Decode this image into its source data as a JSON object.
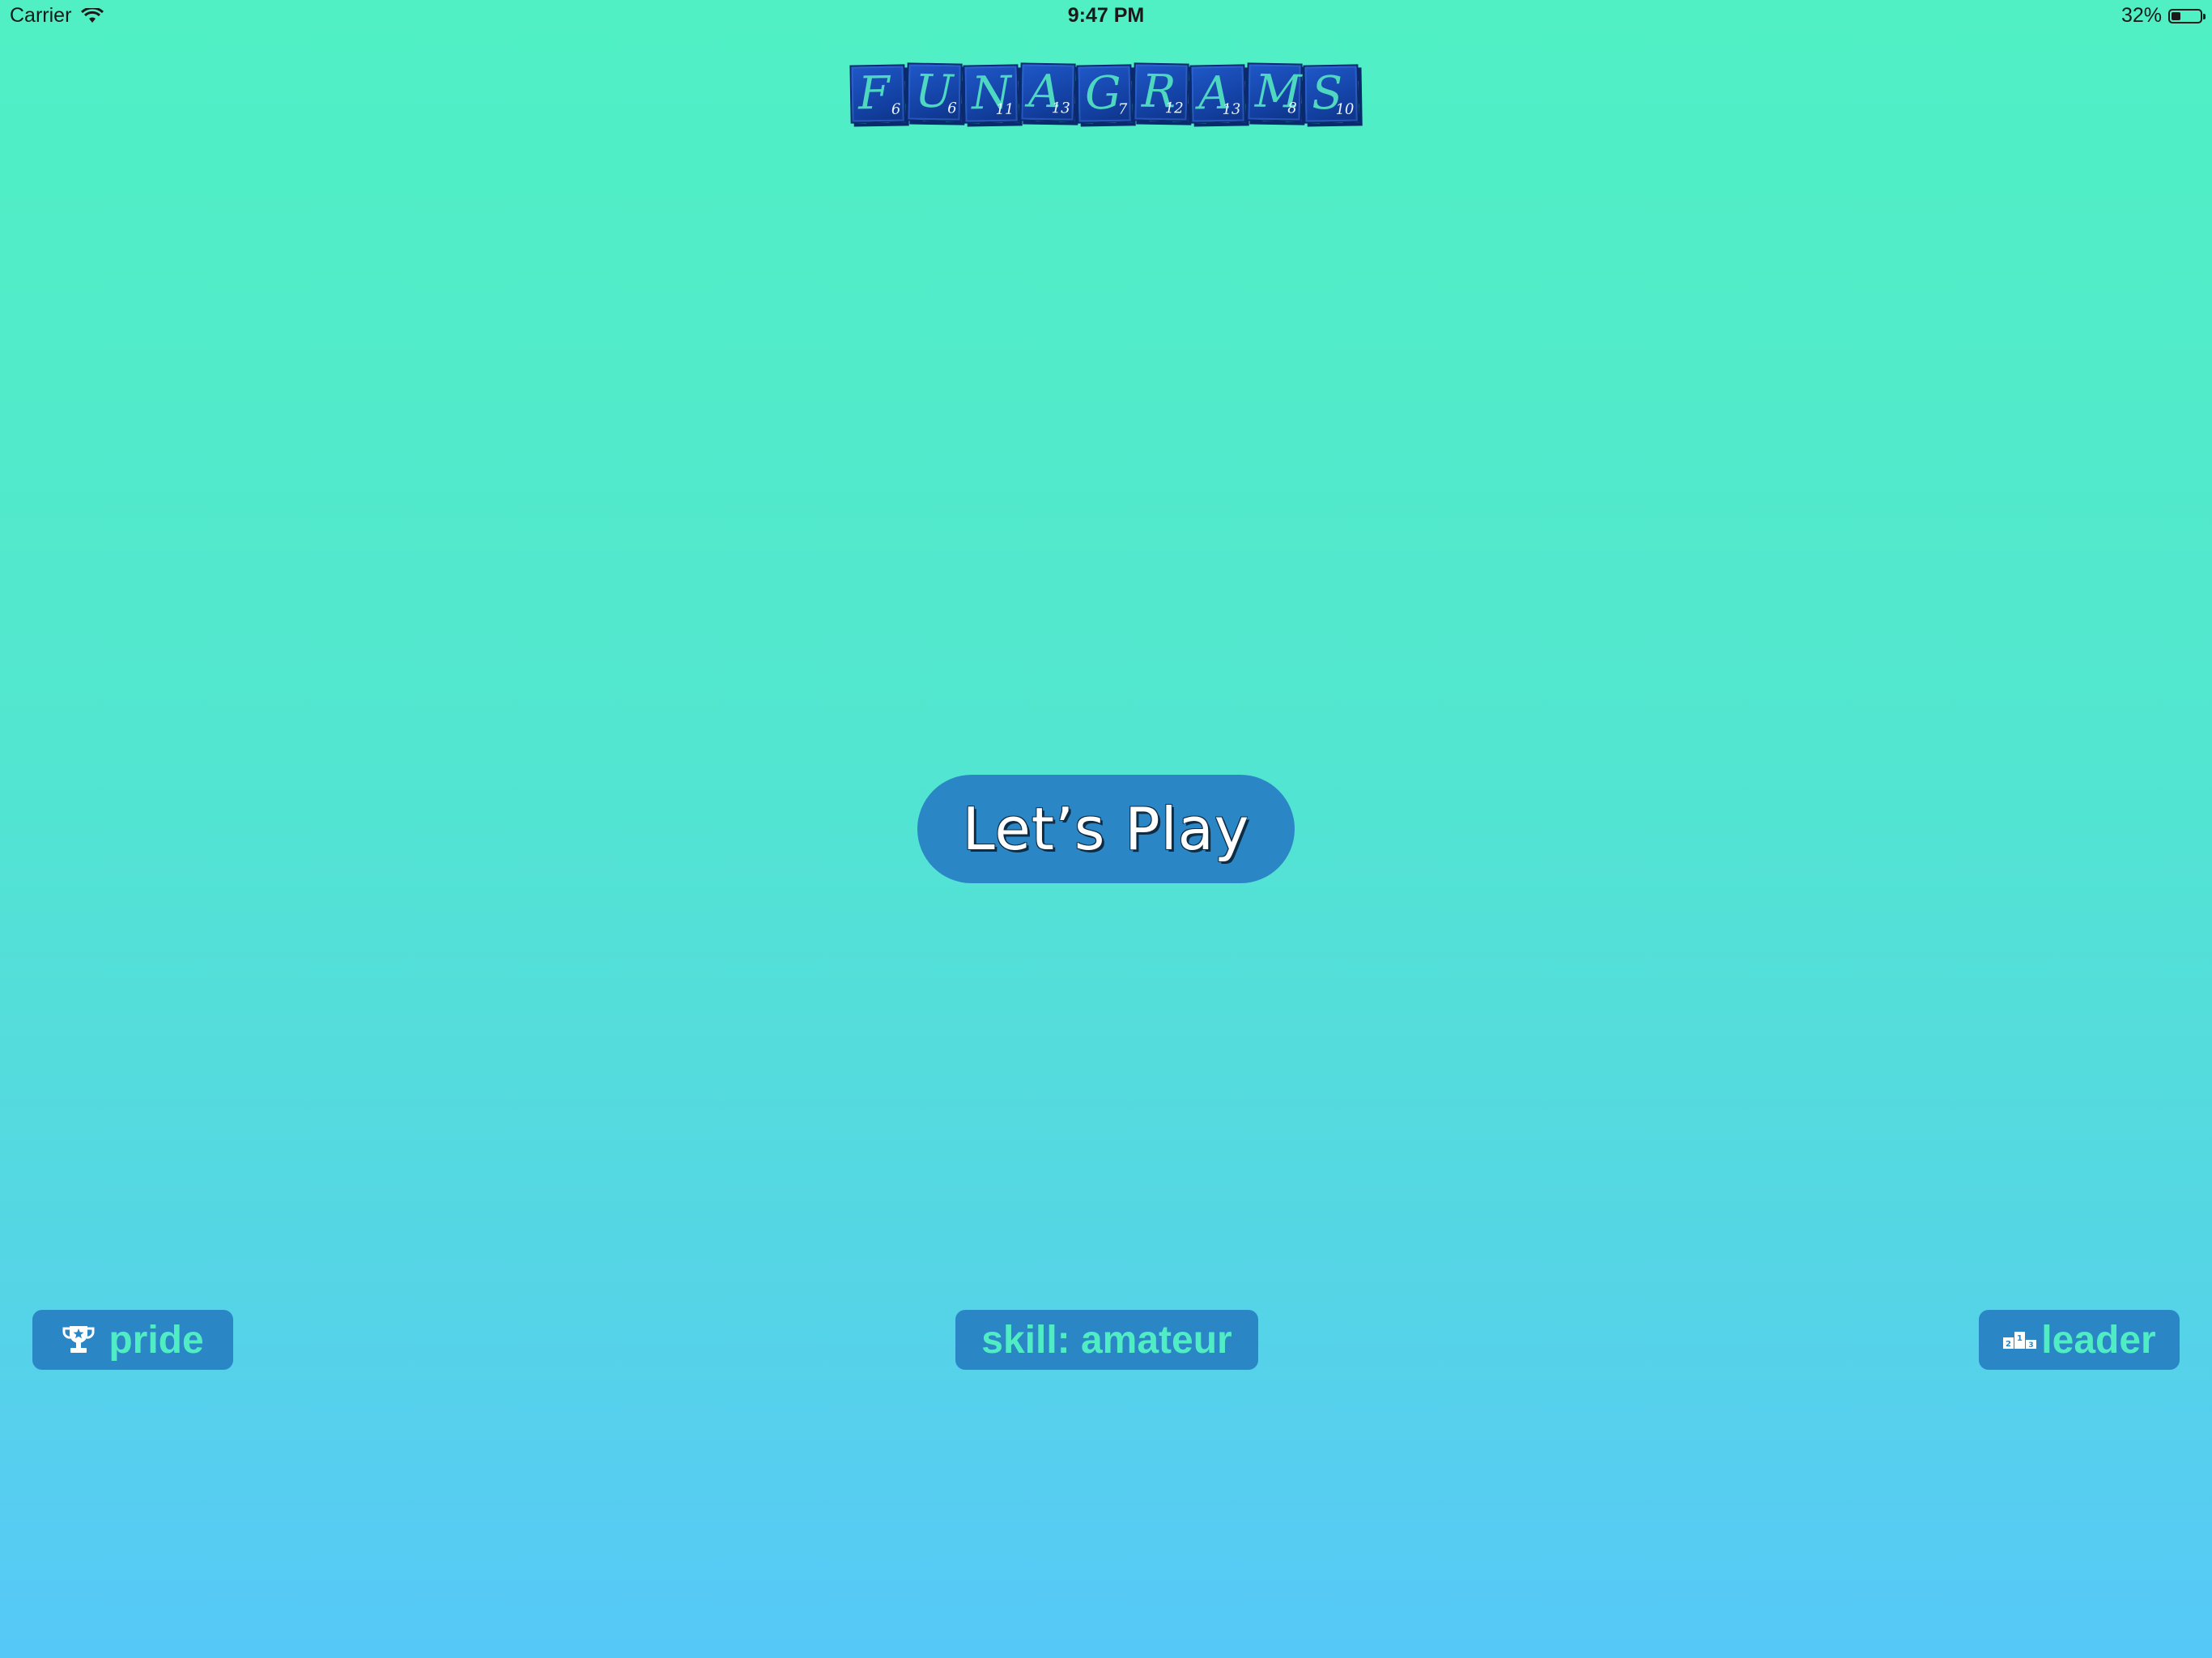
{
  "status_bar": {
    "carrier": "Carrier",
    "time": "9:47 PM",
    "battery_percent_label": "32%",
    "battery_level": 0.32,
    "wifi_icon": "wifi-icon",
    "battery_icon": "battery-icon"
  },
  "logo": {
    "tiles": [
      {
        "letter": "F",
        "score": "6"
      },
      {
        "letter": "U",
        "score": "6"
      },
      {
        "letter": "N",
        "score": "11"
      },
      {
        "letter": "A",
        "score": "13"
      },
      {
        "letter": "G",
        "score": "7"
      },
      {
        "letter": "R",
        "score": "12"
      },
      {
        "letter": "A",
        "score": "13"
      },
      {
        "letter": "M",
        "score": "8"
      },
      {
        "letter": "S",
        "score": "10"
      }
    ]
  },
  "main": {
    "play_label": "Let’s Play"
  },
  "bottom": {
    "pride_label": "pride",
    "pride_icon": "trophy-icon",
    "skill_label": "skill: amateur",
    "leader_label": "leader",
    "leader_icon": "podium-icon"
  },
  "colors": {
    "background_top": "#50f0c4",
    "background_bottom": "#56c8f8",
    "button": "#2b86c6",
    "button_text": "#50ecc4",
    "tile": "#123fa0"
  }
}
